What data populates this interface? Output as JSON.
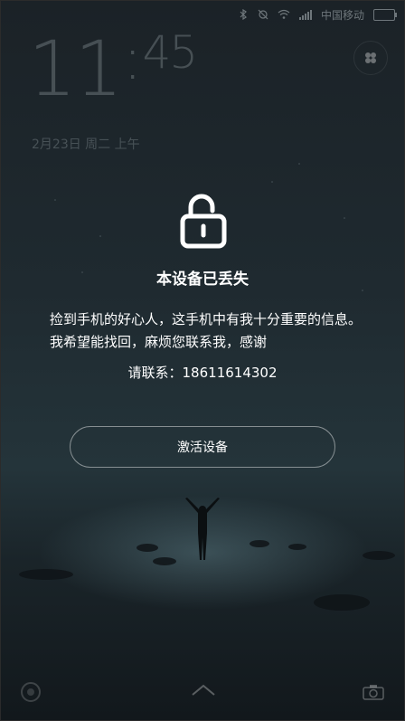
{
  "status_bar": {
    "carrier": "中国移动"
  },
  "clock": {
    "hours": "11",
    "minutes": "45"
  },
  "date": "2月23日 周二 上午",
  "lost_notice": {
    "title": "本设备已丢失",
    "message": "捡到手机的好心人，这手机中有我十分重要的信息。我希望能找回，麻烦您联系我，感谢",
    "contact_label": "请联系：",
    "contact_number": "18611614302"
  },
  "activate_button_label": "激活设备",
  "icons": {
    "lock": "unlocked-padlock-icon",
    "corner": "clover-icon",
    "bottom_left": "circle-icon",
    "bottom_center": "chevron-up-icon",
    "bottom_right": "camera-icon"
  }
}
